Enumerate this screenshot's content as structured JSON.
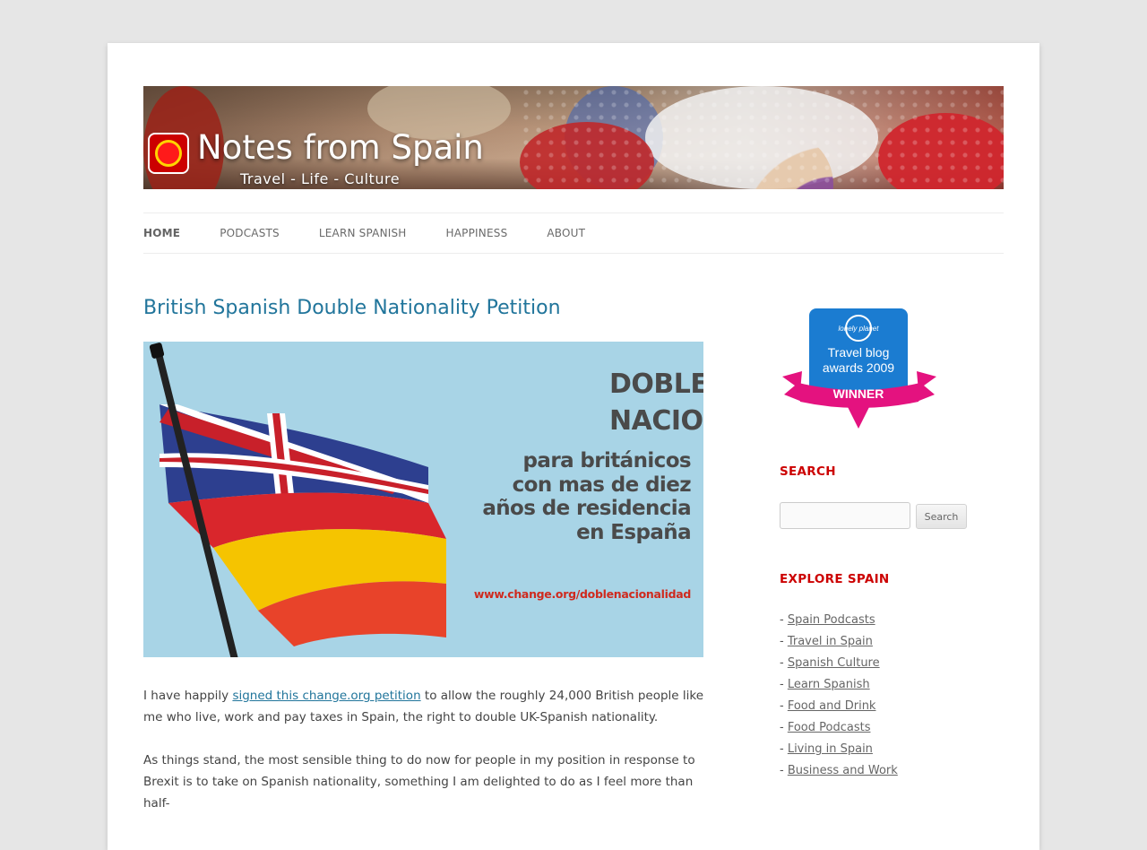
{
  "site": {
    "title": "Notes from Spain",
    "tagline": "Travel - Life - Culture"
  },
  "nav": {
    "items": [
      {
        "label": "HOME",
        "current": true
      },
      {
        "label": "PODCASTS"
      },
      {
        "label": "LEARN SPANISH"
      },
      {
        "label": "HAPPINESS"
      },
      {
        "label": "ABOUT"
      }
    ]
  },
  "post": {
    "title": "British Spanish Double Nationality Petition",
    "image": {
      "line1": "DOBLE",
      "line2": "NACIONALIDAD",
      "line3": "para británicos",
      "line4": "con mas de diez",
      "line5": "años de residencia",
      "line6": "en España",
      "url": "www.change.org/doblenacionalidad"
    },
    "p1_before": "I have happily ",
    "p1_link": "signed this change.org petition",
    "p1_after": " to allow the roughly 24,000 British people like me who live, work and pay taxes in Spain, the right to double UK-Spanish nationality.",
    "p2": "As things stand, the most sensible thing to do now for people in my position in response to Brexit is to take on Spanish nationality, something I am delighted to do as I feel more than half-"
  },
  "sidebar": {
    "award": {
      "brand": "lonely planet",
      "line1": "Travel blog",
      "line2": "awards 2009",
      "ribbon": "WINNER"
    },
    "search_heading": "SEARCH",
    "search_placeholder": "",
    "search_button": "Search",
    "explore_heading": "EXPLORE SPAIN",
    "explore_links": [
      "Spain Podcasts",
      "Travel in Spain",
      "Spanish Culture",
      "Learn Spanish",
      "Food and Drink",
      "Food Podcasts",
      "Living in Spain",
      "Business and Work"
    ]
  },
  "colors": {
    "link": "#21759b",
    "sidebar_heading": "#cc0000",
    "background": "#e6e6e6"
  }
}
